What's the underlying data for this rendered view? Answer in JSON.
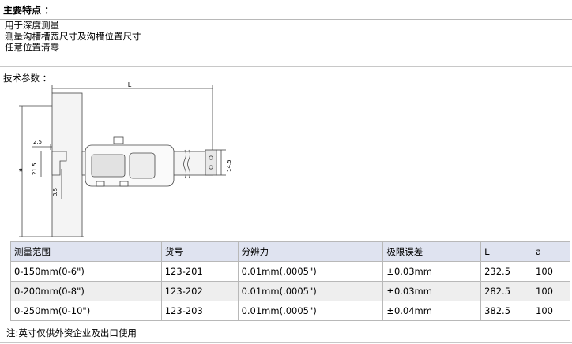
{
  "section_title": "主要特点 ：",
  "features": [
    "用于深度测量",
    "测量沟槽槽宽尺寸及沟槽位置尺寸",
    "任意位置清零"
  ],
  "spec_label": "技术参数 ：",
  "diagram": {
    "dim_L": "L",
    "dim_a": "a",
    "dim_2_5": "2.5",
    "dim_21_5": "21.5",
    "dim_3_5": "3.5",
    "dim_14_5": "14.5"
  },
  "table": {
    "headers": [
      "测量范围",
      "货号",
      "分辨力",
      "极限误差",
      "L",
      "a"
    ],
    "rows": [
      [
        "0-150mm(0-6\")",
        "123-201",
        "0.01mm(.0005\")",
        "±0.03mm",
        "232.5",
        "100"
      ],
      [
        "0-200mm(0-8\")",
        "123-202",
        "0.01mm(.0005\")",
        "±0.03mm",
        "282.5",
        "100"
      ],
      [
        "0-250mm(0-10\")",
        "123-203",
        "0.01mm(.0005\")",
        "±0.04mm",
        "382.5",
        "100"
      ]
    ]
  },
  "note": "注:英寸仅供外资企业及出口使用"
}
